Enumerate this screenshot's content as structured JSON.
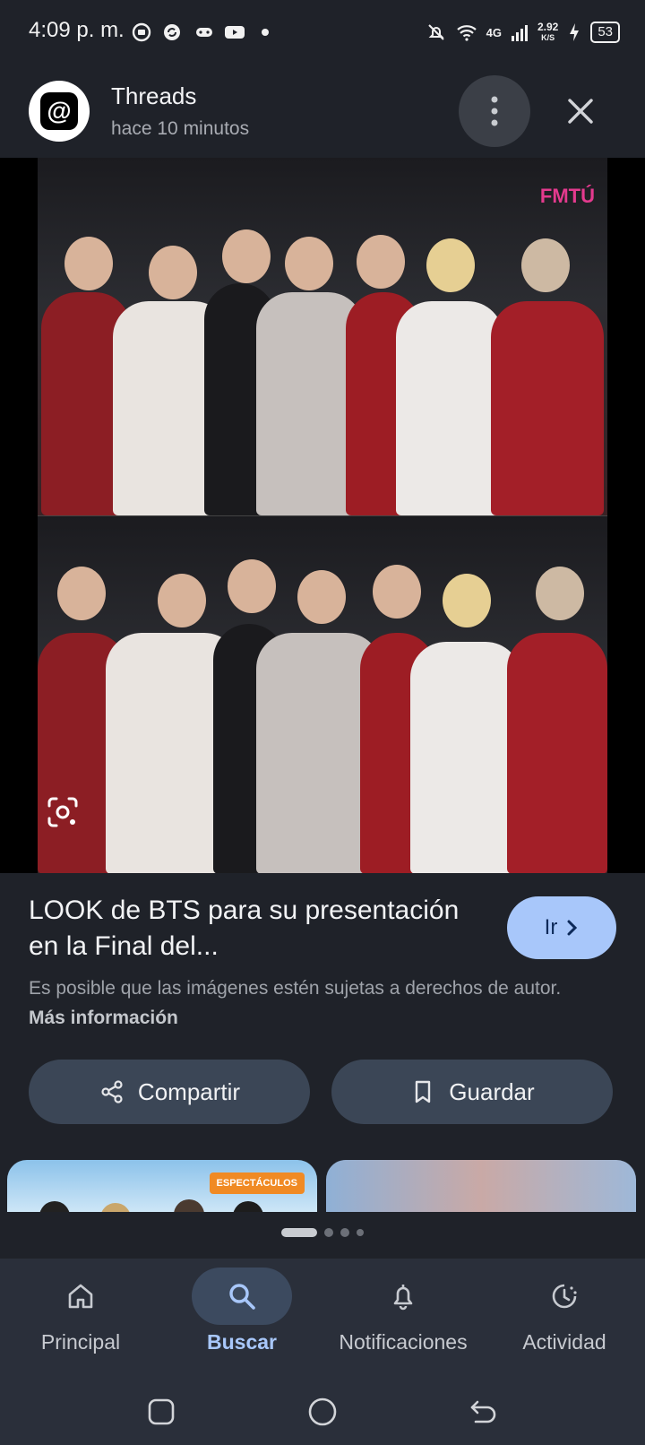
{
  "status_bar": {
    "time": "4:09 p. m.",
    "network": "4G",
    "speed": "2.92",
    "speed_unit": "K/S",
    "battery": "53"
  },
  "header": {
    "app_name": "Threads",
    "timestamp": "hace 10 minutos",
    "logo_glyph": "@"
  },
  "image": {
    "watermark": "FMTÚ"
  },
  "result": {
    "title": "LOOK de BTS para su presentación en la Final del...",
    "go_label": "Ir",
    "disclaimer": "Es posible que las imágenes estén sujetas a derechos de autor.",
    "more_info": "Más información"
  },
  "actions": {
    "share_label": "Compartir",
    "save_label": "Guardar"
  },
  "related": {
    "badge": "ESPECTÁCULOS"
  },
  "bottom_nav": {
    "items": [
      {
        "label": "Principal",
        "icon": "home-icon"
      },
      {
        "label": "Buscar",
        "icon": "search-icon"
      },
      {
        "label": "Notificaciones",
        "icon": "bell-icon"
      },
      {
        "label": "Actividad",
        "icon": "activity-icon"
      }
    ],
    "active": "Buscar"
  },
  "colors": {
    "background": "#1f2229",
    "accent": "#a8c7fa",
    "button": "#3b4656"
  }
}
